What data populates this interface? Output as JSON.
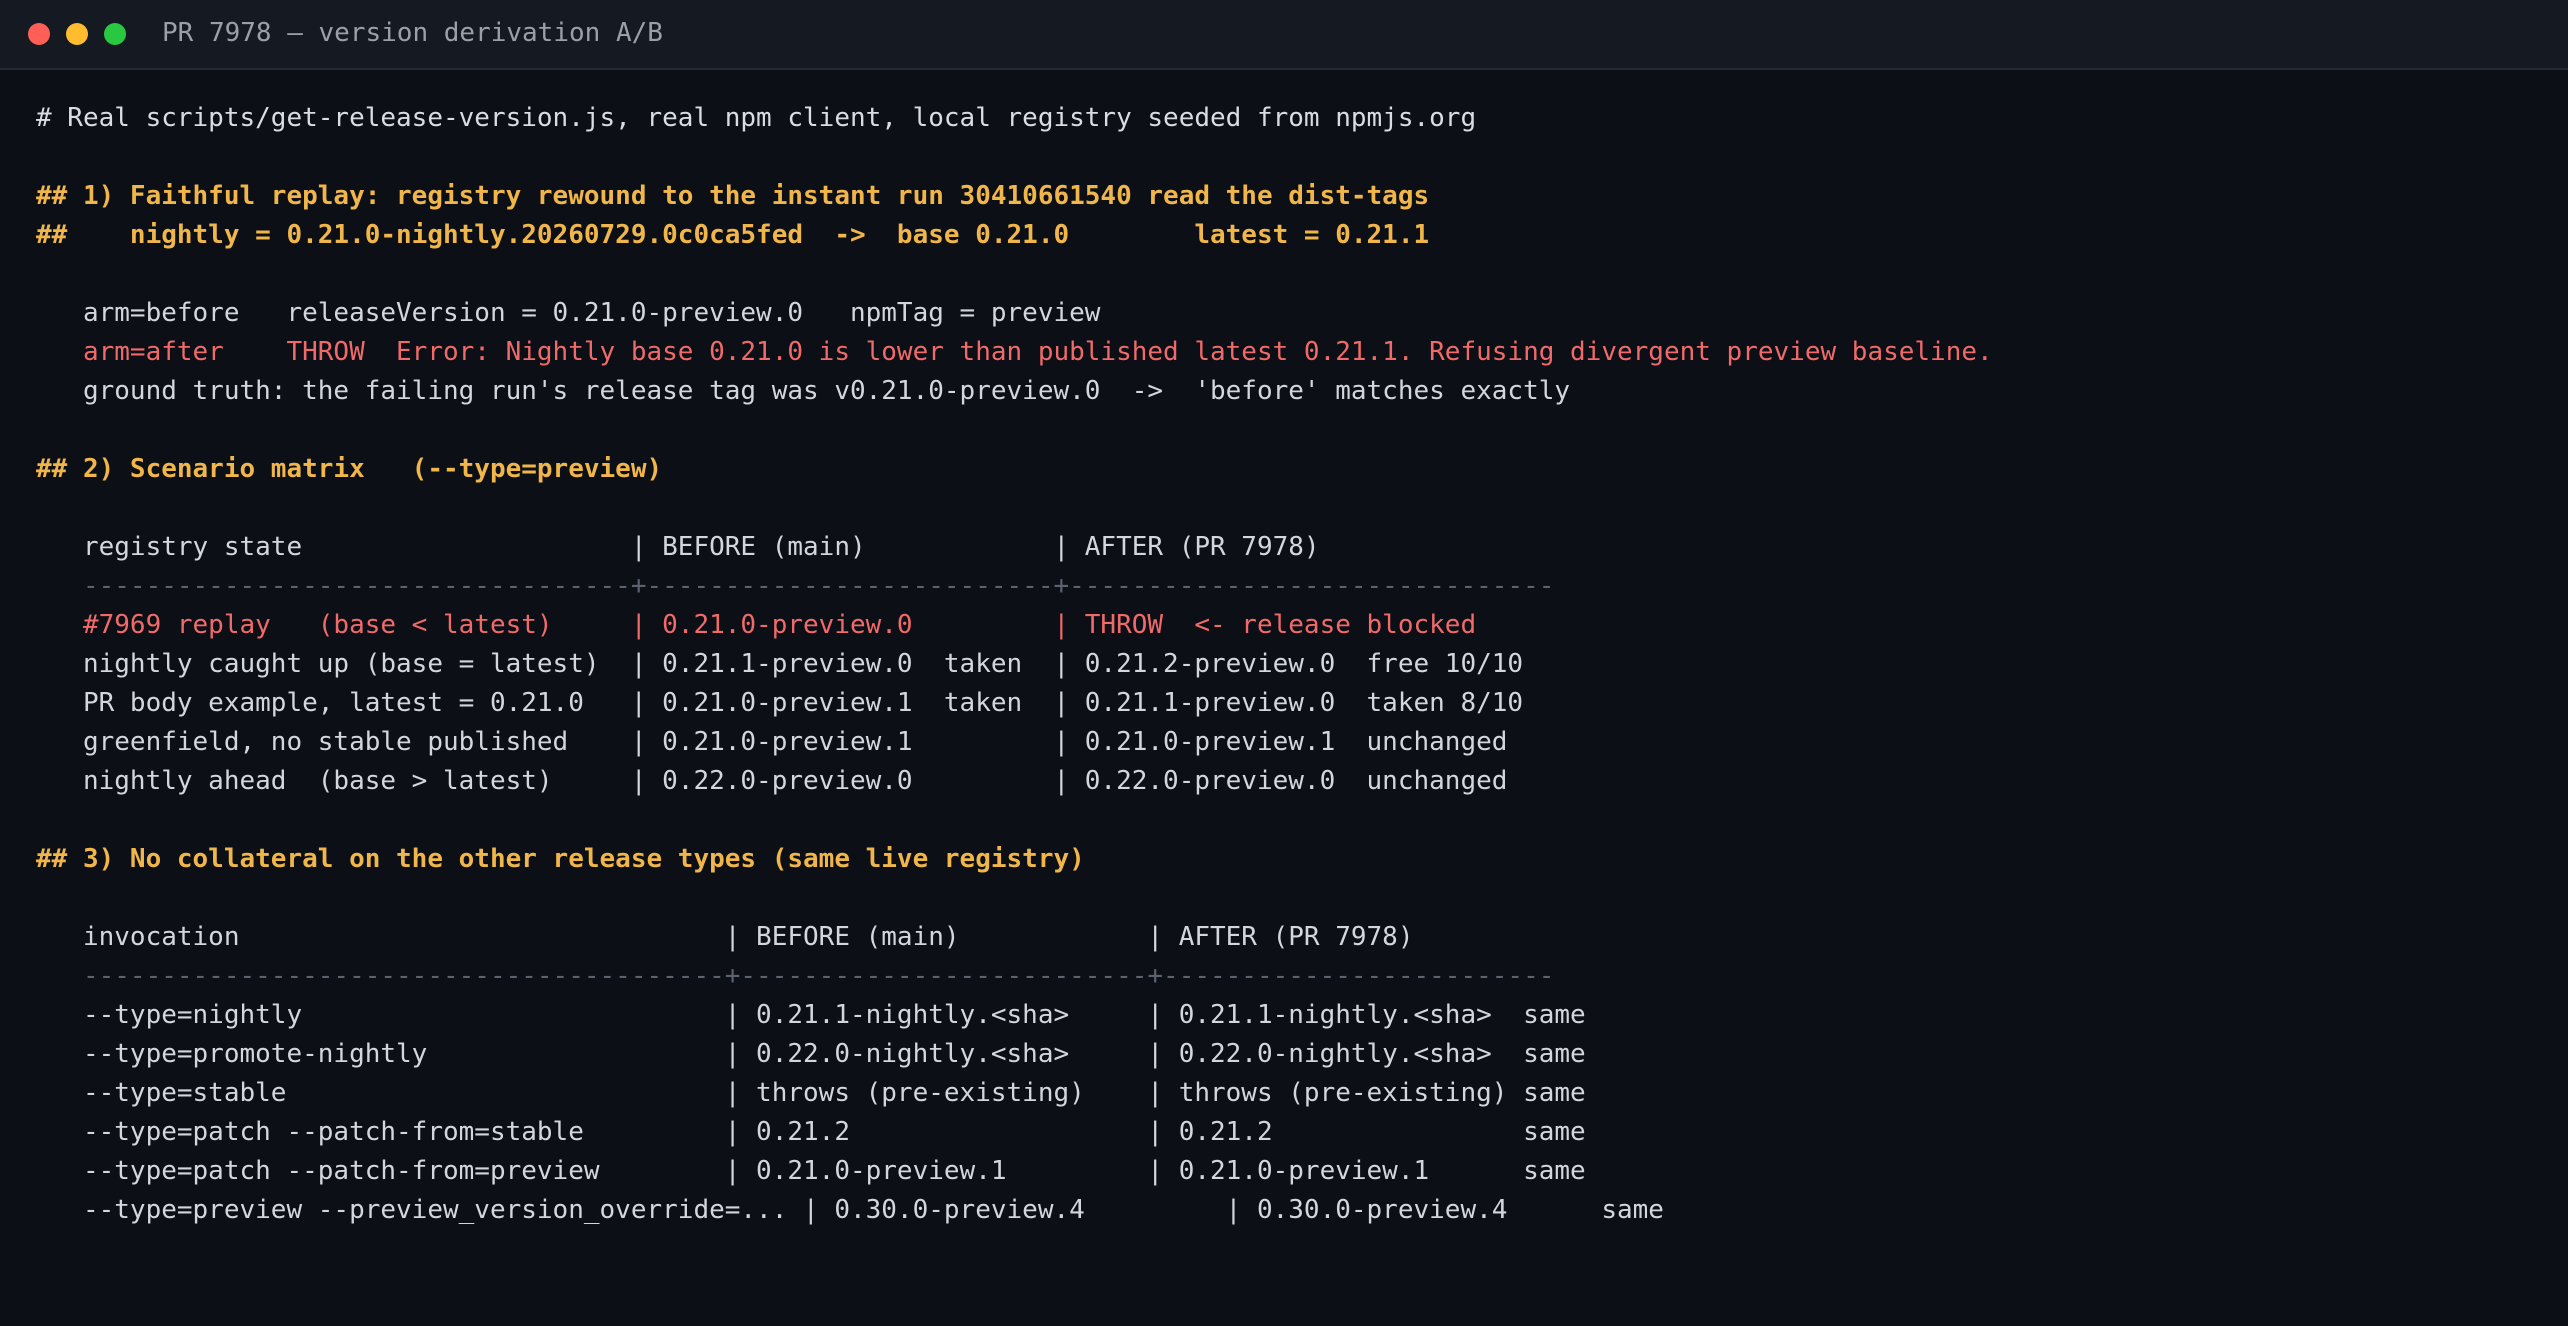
{
  "window": {
    "title": "PR 7978 — version derivation A/B",
    "colors": {
      "background": "#0c0f15",
      "titlebar": "#151922",
      "text": "#d3d6dc",
      "heading": "#f0b64a",
      "error": "#f06a6a",
      "rule": "#5b6270",
      "close": "#ff5f57",
      "minimize": "#febc2e",
      "zoom": "#28c840"
    }
  },
  "terminal": {
    "lines": [
      {
        "kind": "comment",
        "text": "# Real scripts/get-release-version.js, real npm client, local registry seeded from npmjs.org"
      },
      {
        "kind": "blank",
        "text": ""
      },
      {
        "kind": "heading",
        "text": "## 1) Faithful replay: registry rewound to the instant run 30410661540 read the dist-tags"
      },
      {
        "kind": "heading",
        "text": "##    nightly = 0.21.0-nightly.20260729.0c0ca5fed  ->  base 0.21.0        latest = 0.21.1"
      },
      {
        "kind": "blank",
        "text": ""
      },
      {
        "kind": "plain",
        "text": "   arm=before   releaseVersion = 0.21.0-preview.0   npmTag = preview"
      },
      {
        "kind": "error",
        "text": "   arm=after    THROW  Error: Nightly base 0.21.0 is lower than published latest 0.21.1. Refusing divergent preview baseline."
      },
      {
        "kind": "plain",
        "text": "   ground truth: the failing run's release tag was v0.21.0-preview.0  ->  'before' matches exactly"
      },
      {
        "kind": "blank",
        "text": ""
      },
      {
        "kind": "heading",
        "text": "## 2) Scenario matrix   (--type=preview)"
      },
      {
        "kind": "blank",
        "text": ""
      },
      {
        "kind": "plain",
        "text": "   registry state                     | BEFORE (main)            | AFTER (PR 7978)"
      },
      {
        "kind": "rule",
        "text": "   -----------------------------------+--------------------------+-------------------------------"
      },
      {
        "kind": "error",
        "text": "   #7969 replay   (base < latest)     | 0.21.0-preview.0         | THROW  <- release blocked"
      },
      {
        "kind": "plain",
        "text": "   nightly caught up (base = latest)  | 0.21.1-preview.0  taken  | 0.21.2-preview.0  free 10/10"
      },
      {
        "kind": "plain",
        "text": "   PR body example, latest = 0.21.0   | 0.21.0-preview.1  taken  | 0.21.1-preview.0  taken 8/10"
      },
      {
        "kind": "plain",
        "text": "   greenfield, no stable published    | 0.21.0-preview.1         | 0.21.0-preview.1  unchanged"
      },
      {
        "kind": "plain",
        "text": "   nightly ahead  (base > latest)     | 0.22.0-preview.0         | 0.22.0-preview.0  unchanged"
      },
      {
        "kind": "blank",
        "text": ""
      },
      {
        "kind": "heading",
        "text": "## 3) No collateral on the other release types (same live registry)"
      },
      {
        "kind": "blank",
        "text": ""
      },
      {
        "kind": "plain",
        "text": "   invocation                               | BEFORE (main)            | AFTER (PR 7978)"
      },
      {
        "kind": "rule",
        "text": "   -----------------------------------------+--------------------------+-------------------------"
      },
      {
        "kind": "plain",
        "text": "   --type=nightly                           | 0.21.1-nightly.<sha>     | 0.21.1-nightly.<sha>  same"
      },
      {
        "kind": "plain",
        "text": "   --type=promote-nightly                   | 0.22.0-nightly.<sha>     | 0.22.0-nightly.<sha>  same"
      },
      {
        "kind": "plain",
        "text": "   --type=stable                            | throws (pre-existing)    | throws (pre-existing) same"
      },
      {
        "kind": "plain",
        "text": "   --type=patch --patch-from=stable         | 0.21.2                   | 0.21.2                same"
      },
      {
        "kind": "plain",
        "text": "   --type=patch --patch-from=preview        | 0.21.0-preview.1         | 0.21.0-preview.1      same"
      },
      {
        "kind": "plain",
        "text": "   --type=preview --preview_version_override=... | 0.30.0-preview.4         | 0.30.0-preview.4      same"
      }
    ]
  }
}
